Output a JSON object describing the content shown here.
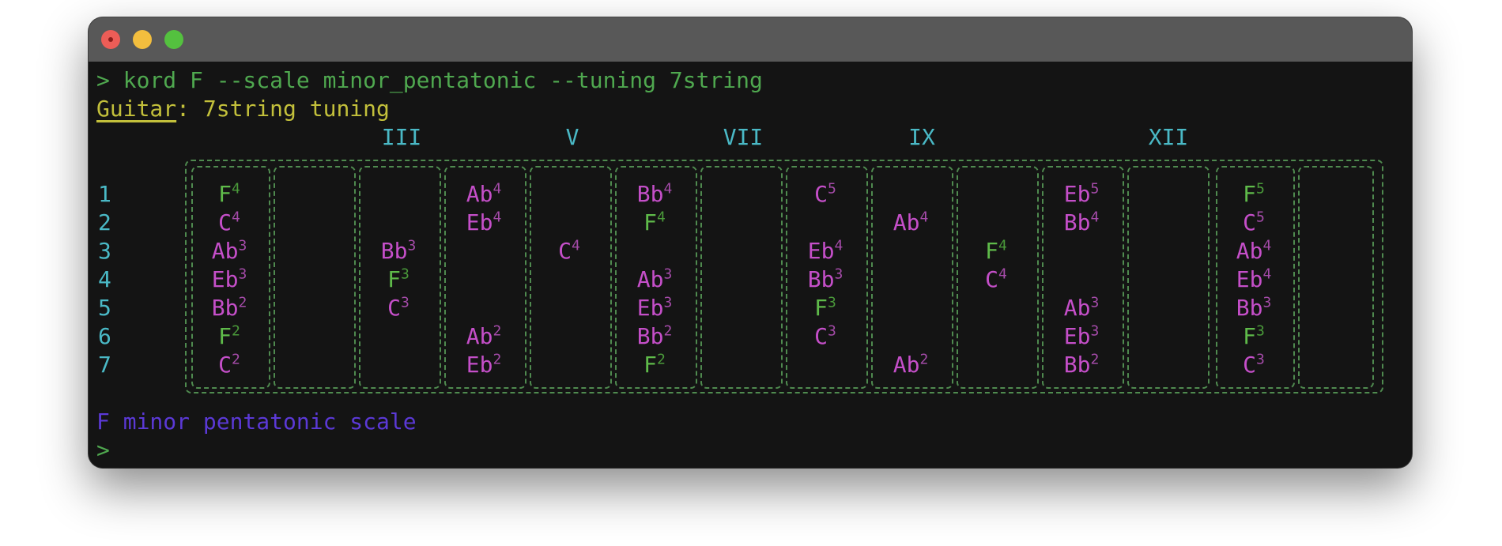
{
  "terminal": {
    "command": "> kord F --scale minor_pentatonic --tuning 7string",
    "guitar_label": "Guitar",
    "guitar_rest": ": 7string tuning",
    "scale_name": "F minor pentatonic scale",
    "prompt": ">"
  },
  "fret_markers": [
    "III",
    "V",
    "VII",
    "IX",
    "XII"
  ],
  "string_numbers": [
    "1",
    "2",
    "3",
    "4",
    "5",
    "6",
    "7"
  ],
  "fretboard": [
    {
      "fret": 0,
      "notes": [
        {
          "s": 1,
          "n": "F",
          "o": "4",
          "root": true
        },
        {
          "s": 2,
          "n": "C",
          "o": "4"
        },
        {
          "s": 3,
          "n": "Ab",
          "o": "3"
        },
        {
          "s": 4,
          "n": "Eb",
          "o": "3"
        },
        {
          "s": 5,
          "n": "Bb",
          "o": "2"
        },
        {
          "s": 6,
          "n": "F",
          "o": "2",
          "root": true
        },
        {
          "s": 7,
          "n": "C",
          "o": "2"
        }
      ]
    },
    {
      "fret": 2,
      "notes": [
        {
          "s": 3,
          "n": "Bb",
          "o": "3"
        },
        {
          "s": 4,
          "n": "F",
          "o": "3",
          "root": true
        },
        {
          "s": 5,
          "n": "C",
          "o": "3"
        }
      ]
    },
    {
      "fret": 3,
      "notes": [
        {
          "s": 1,
          "n": "Ab",
          "o": "4"
        },
        {
          "s": 2,
          "n": "Eb",
          "o": "4"
        },
        {
          "s": 6,
          "n": "Ab",
          "o": "2"
        },
        {
          "s": 7,
          "n": "Eb",
          "o": "2"
        }
      ]
    },
    {
      "fret": 4,
      "notes": [
        {
          "s": 3,
          "n": "C",
          "o": "4"
        }
      ]
    },
    {
      "fret": 5,
      "notes": [
        {
          "s": 1,
          "n": "Bb",
          "o": "4"
        },
        {
          "s": 2,
          "n": "F",
          "o": "4",
          "root": true
        },
        {
          "s": 4,
          "n": "Ab",
          "o": "3"
        },
        {
          "s": 5,
          "n": "Eb",
          "o": "3"
        },
        {
          "s": 6,
          "n": "Bb",
          "o": "2"
        },
        {
          "s": 7,
          "n": "F",
          "o": "2",
          "root": true
        }
      ]
    },
    {
      "fret": 7,
      "notes": [
        {
          "s": 1,
          "n": "C",
          "o": "5"
        },
        {
          "s": 3,
          "n": "Eb",
          "o": "4"
        },
        {
          "s": 4,
          "n": "Bb",
          "o": "3"
        },
        {
          "s": 5,
          "n": "F",
          "o": "3",
          "root": true
        },
        {
          "s": 6,
          "n": "C",
          "o": "3"
        }
      ]
    },
    {
      "fret": 8,
      "notes": [
        {
          "s": 2,
          "n": "Ab",
          "o": "4"
        },
        {
          "s": 7,
          "n": "Ab",
          "o": "2"
        }
      ]
    },
    {
      "fret": 9,
      "notes": [
        {
          "s": 3,
          "n": "F",
          "o": "4",
          "root": true
        },
        {
          "s": 4,
          "n": "C",
          "o": "4"
        }
      ]
    },
    {
      "fret": 10,
      "notes": [
        {
          "s": 1,
          "n": "Eb",
          "o": "5"
        },
        {
          "s": 2,
          "n": "Bb",
          "o": "4"
        },
        {
          "s": 5,
          "n": "Ab",
          "o": "3"
        },
        {
          "s": 6,
          "n": "Eb",
          "o": "3"
        },
        {
          "s": 7,
          "n": "Bb",
          "o": "2"
        }
      ]
    },
    {
      "fret": 12,
      "notes": [
        {
          "s": 1,
          "n": "F",
          "o": "5",
          "root": true
        },
        {
          "s": 2,
          "n": "C",
          "o": "5"
        },
        {
          "s": 3,
          "n": "Ab",
          "o": "4"
        },
        {
          "s": 4,
          "n": "Eb",
          "o": "4"
        },
        {
          "s": 5,
          "n": "Bb",
          "o": "3"
        },
        {
          "s": 6,
          "n": "F",
          "o": "3",
          "root": true
        },
        {
          "s": 7,
          "n": "C",
          "o": "3"
        }
      ]
    }
  ],
  "colors": {
    "background": "#141414",
    "titlebar": "#585858",
    "command": "#4fa84f",
    "guitar": "#c3c03b",
    "markers": "#4ab9c6",
    "root_note": "#5fbb4a",
    "scale_note": "#c54fc9",
    "scale_name": "#5b39d6",
    "fretboard_border": "#4f8a4f"
  }
}
